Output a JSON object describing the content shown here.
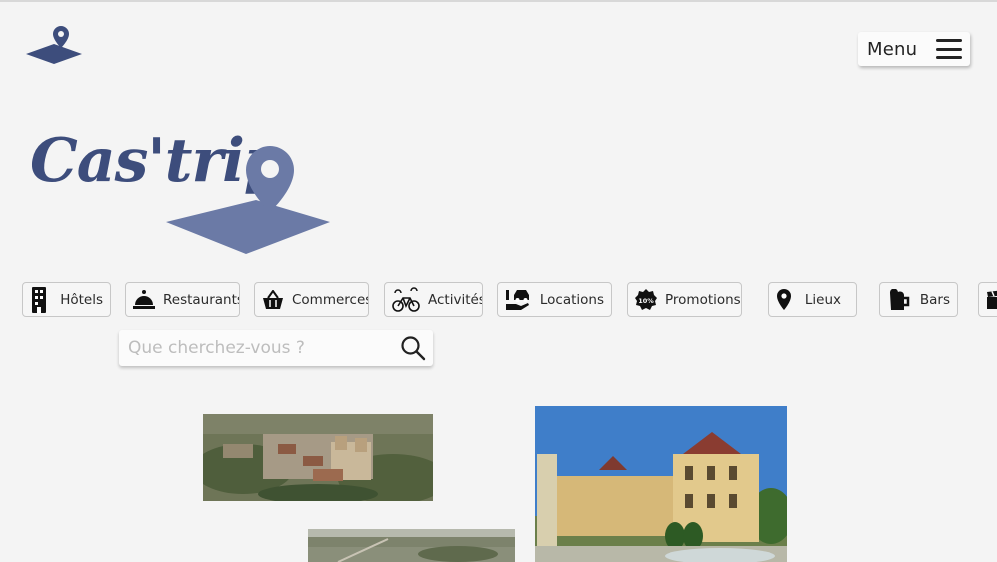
{
  "header": {
    "menu_label": "Menu",
    "small_logo_icon": "map-pin-on-tile-icon",
    "hamburger_icon": "hamburger-icon"
  },
  "brand": {
    "name": "Cas'trip",
    "color": "#3d4d7c",
    "pin_color": "#6b7aa6"
  },
  "categories": [
    {
      "label": "Hôtels",
      "icon": "hotel-building-icon"
    },
    {
      "label": "Restaurants",
      "icon": "cloche-icon"
    },
    {
      "label": "Commerces",
      "icon": "basket-icon"
    },
    {
      "label": "Activités",
      "icon": "bicycle-icon"
    },
    {
      "label": "Locations",
      "icon": "car-rental-icon"
    },
    {
      "label": "Promotions",
      "icon": "discount-badge-icon"
    },
    {
      "label": "Lieux",
      "icon": "map-pin-icon"
    },
    {
      "label": "Bars",
      "icon": "beer-mug-icon"
    },
    {
      "label": "",
      "icon": "clapperboard-icon"
    }
  ],
  "search": {
    "placeholder": "Que cherchez-vous ?",
    "value": "",
    "icon": "search-icon"
  },
  "photos": [
    {
      "subject": "aerial-village",
      "icon": "aerial-village-photo"
    },
    {
      "subject": "chateau",
      "icon": "chateau-photo"
    },
    {
      "subject": "aerial-landscape",
      "icon": "aerial-landscape-photo"
    }
  ]
}
